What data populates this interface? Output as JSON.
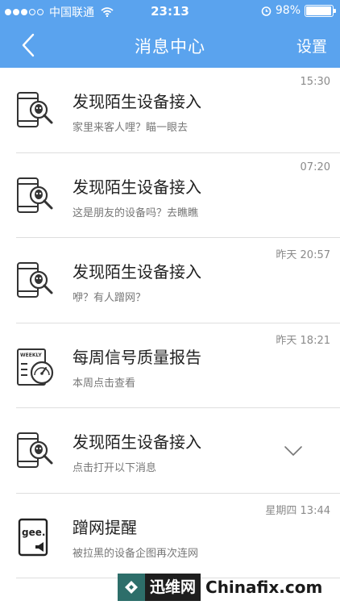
{
  "status_bar": {
    "carrier": "中国联通",
    "time": "23:13",
    "battery": "98%",
    "battery_level": 0.98
  },
  "nav": {
    "title": "消息中心",
    "settings_label": "设置",
    "back_icon": "chevron-left-icon"
  },
  "colors": {
    "header_bg": "#5aa3ee",
    "divider": "#dedede"
  },
  "messages": [
    {
      "icon": "phone-search-icon",
      "title": "发现陌生设备接入",
      "subtitle": "家里来客人哩？瞄一眼去",
      "time": "15:30"
    },
    {
      "icon": "phone-search-icon",
      "title": "发现陌生设备接入",
      "subtitle": "这是朋友的设备吗？去瞧瞧",
      "time": "07:20"
    },
    {
      "icon": "phone-search-icon",
      "title": "发现陌生设备接入",
      "subtitle": "咿？有人蹭网？",
      "time": "昨天 20:57"
    },
    {
      "icon": "weekly-report-icon",
      "icon_text": "WEEKLY",
      "title": "每周信号质量报告",
      "subtitle": "本周点击查看",
      "time": "昨天 18:21"
    },
    {
      "icon": "phone-search-icon",
      "title": "发现陌生设备接入",
      "subtitle": "点击打开以下消息",
      "time": "",
      "expand_icon": "chevron-down-icon"
    },
    {
      "icon": "gee-alert-icon",
      "icon_text": "gee.",
      "title": "蹭网提醒",
      "subtitle": "被拉黑的设备企图再次连网",
      "time": "星期四 13:44"
    }
  ],
  "watermark": {
    "brand": "迅维网",
    "site": "Chinafix.com"
  }
}
